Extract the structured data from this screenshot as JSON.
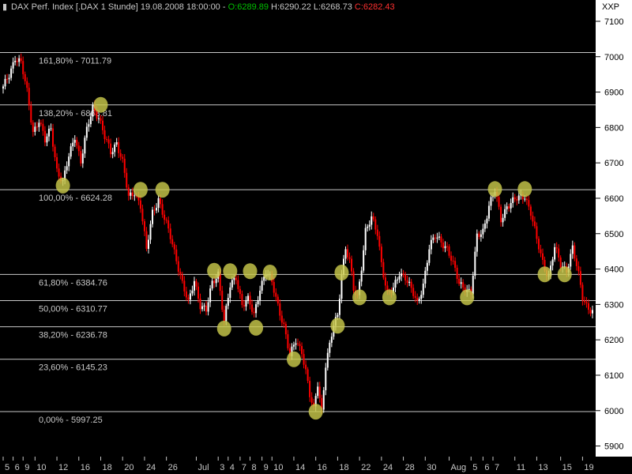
{
  "chart_data": {
    "type": "candlestick",
    "title": {
      "instrument": "DAX Perf. Index [.DAX  1 Stunde]",
      "datetime": "19.08.2008 18:00:00",
      "open": "O:6289.89",
      "high": "H:6290.22",
      "low": "L:6268.73",
      "close": "C:6282.43"
    },
    "y_axis_label": "XXP",
    "ylim": [
      5870,
      7150
    ],
    "yticks": [
      5900,
      6000,
      6100,
      6200,
      6300,
      6400,
      6500,
      6600,
      6700,
      6800,
      6900,
      7000,
      7100
    ],
    "ytick_labels": [
      "5900",
      "6000",
      "6100",
      "6200",
      "6300",
      "6400",
      "6500",
      "6600",
      "6700",
      "6800",
      "6900",
      "7000",
      "7100"
    ],
    "xticks": [
      {
        "label": "5",
        "i": 0
      },
      {
        "label": "6",
        "i": 5
      },
      {
        "label": "9",
        "i": 10
      },
      {
        "label": "10",
        "i": 16
      },
      {
        "label": "12",
        "i": 27
      },
      {
        "label": "16",
        "i": 38
      },
      {
        "label": "18",
        "i": 49
      },
      {
        "label": "20",
        "i": 60
      },
      {
        "label": "24",
        "i": 71
      },
      {
        "label": "26",
        "i": 82
      },
      {
        "label": "Jul",
        "i": 97
      },
      {
        "label": "3",
        "i": 108
      },
      {
        "label": "4",
        "i": 113
      },
      {
        "label": "7",
        "i": 119
      },
      {
        "label": "8",
        "i": 124
      },
      {
        "label": "9",
        "i": 130
      },
      {
        "label": "10",
        "i": 135
      },
      {
        "label": "14",
        "i": 146
      },
      {
        "label": "16",
        "i": 157
      },
      {
        "label": "18",
        "i": 168
      },
      {
        "label": "22",
        "i": 179
      },
      {
        "label": "24",
        "i": 190
      },
      {
        "label": "28",
        "i": 201
      },
      {
        "label": "30",
        "i": 212
      },
      {
        "label": "Aug",
        "i": 224
      },
      {
        "label": "5",
        "i": 235
      },
      {
        "label": "6",
        "i": 241
      },
      {
        "label": "7",
        "i": 246
      },
      {
        "label": "11",
        "i": 257
      },
      {
        "label": "13",
        "i": 268
      },
      {
        "label": "15",
        "i": 280
      },
      {
        "label": "19",
        "i": 291
      }
    ],
    "fib_levels": [
      {
        "label": "161,80% - 7011.79",
        "value": 7011.79
      },
      {
        "label": "138,20% - 6863.81",
        "value": 6863.81
      },
      {
        "label": "100,00% - 6624.28",
        "value": 6624.28
      },
      {
        "label": "61,80% - 6384.76",
        "value": 6384.76
      },
      {
        "label": "50,00% - 6310.77",
        "value": 6310.77
      },
      {
        "label": "38,20% - 6236.78",
        "value": 6236.78
      },
      {
        "label": "23,60% - 6145.23",
        "value": 6145.23
      },
      {
        "label": "0,00% - 5997.25",
        "value": 5997.25
      }
    ],
    "path_anchors": [
      [
        0,
        6910
      ],
      [
        3,
        6950
      ],
      [
        6,
        7000
      ],
      [
        9,
        6980
      ],
      [
        12,
        6900
      ],
      [
        15,
        6790
      ],
      [
        18,
        6820
      ],
      [
        21,
        6760
      ],
      [
        24,
        6800
      ],
      [
        27,
        6680
      ],
      [
        30,
        6640
      ],
      [
        33,
        6720
      ],
      [
        36,
        6780
      ],
      [
        39,
        6700
      ],
      [
        42,
        6790
      ],
      [
        45,
        6860
      ],
      [
        48,
        6830
      ],
      [
        51,
        6770
      ],
      [
        54,
        6730
      ],
      [
        57,
        6760
      ],
      [
        60,
        6700
      ],
      [
        63,
        6600
      ],
      [
        66,
        6620
      ],
      [
        69,
        6580
      ],
      [
        72,
        6450
      ],
      [
        75,
        6560
      ],
      [
        78,
        6600
      ],
      [
        81,
        6540
      ],
      [
        84,
        6490
      ],
      [
        87,
        6430
      ],
      [
        90,
        6360
      ],
      [
        93,
        6300
      ],
      [
        96,
        6370
      ],
      [
        99,
        6300
      ],
      [
        102,
        6280
      ],
      [
        105,
        6360
      ],
      [
        108,
        6390
      ],
      [
        111,
        6250
      ],
      [
        114,
        6350
      ],
      [
        117,
        6380
      ],
      [
        120,
        6300
      ],
      [
        123,
        6310
      ],
      [
        126,
        6270
      ],
      [
        129,
        6350
      ],
      [
        132,
        6390
      ],
      [
        135,
        6360
      ],
      [
        138,
        6300
      ],
      [
        141,
        6240
      ],
      [
        144,
        6150
      ],
      [
        147,
        6200
      ],
      [
        150,
        6170
      ],
      [
        152,
        6110
      ],
      [
        154,
        6040
      ],
      [
        156,
        6000
      ],
      [
        158,
        6080
      ],
      [
        160,
        6000
      ],
      [
        162,
        6130
      ],
      [
        164,
        6180
      ],
      [
        166,
        6240
      ],
      [
        168,
        6270
      ],
      [
        170,
        6390
      ],
      [
        172,
        6460
      ],
      [
        174,
        6420
      ],
      [
        176,
        6340
      ],
      [
        178,
        6320
      ],
      [
        180,
        6410
      ],
      [
        182,
        6510
      ],
      [
        185,
        6540
      ],
      [
        188,
        6500
      ],
      [
        190,
        6420
      ],
      [
        193,
        6330
      ],
      [
        196,
        6340
      ],
      [
        199,
        6390
      ],
      [
        202,
        6380
      ],
      [
        205,
        6340
      ],
      [
        208,
        6300
      ],
      [
        211,
        6360
      ],
      [
        214,
        6460
      ],
      [
        217,
        6490
      ],
      [
        220,
        6480
      ],
      [
        223,
        6460
      ],
      [
        226,
        6410
      ],
      [
        229,
        6360
      ],
      [
        232,
        6350
      ],
      [
        235,
        6330
      ],
      [
        238,
        6490
      ],
      [
        241,
        6510
      ],
      [
        244,
        6580
      ],
      [
        247,
        6620
      ],
      [
        250,
        6540
      ],
      [
        253,
        6580
      ],
      [
        256,
        6590
      ],
      [
        259,
        6600
      ],
      [
        262,
        6610
      ],
      [
        265,
        6560
      ],
      [
        268,
        6480
      ],
      [
        271,
        6420
      ],
      [
        274,
        6380
      ],
      [
        277,
        6460
      ],
      [
        280,
        6410
      ],
      [
        283,
        6400
      ],
      [
        286,
        6460
      ],
      [
        289,
        6380
      ],
      [
        291,
        6320
      ],
      [
        293,
        6300
      ],
      [
        296,
        6280
      ]
    ],
    "highlights": [
      {
        "i": 30,
        "value": 6636
      },
      {
        "i": 49,
        "value": 6864
      },
      {
        "i": 69,
        "value": 6624
      },
      {
        "i": 80,
        "value": 6624
      },
      {
        "i": 106,
        "value": 6395
      },
      {
        "i": 111,
        "value": 6232
      },
      {
        "i": 114,
        "value": 6394
      },
      {
        "i": 124,
        "value": 6394
      },
      {
        "i": 127,
        "value": 6234
      },
      {
        "i": 134,
        "value": 6390
      },
      {
        "i": 146,
        "value": 6145
      },
      {
        "i": 157,
        "value": 5997
      },
      {
        "i": 168,
        "value": 6240
      },
      {
        "i": 170,
        "value": 6390
      },
      {
        "i": 179,
        "value": 6320
      },
      {
        "i": 194,
        "value": 6320
      },
      {
        "i": 233,
        "value": 6320
      },
      {
        "i": 247,
        "value": 6626
      },
      {
        "i": 262,
        "value": 6626
      },
      {
        "i": 272,
        "value": 6385
      },
      {
        "i": 282,
        "value": 6385
      }
    ],
    "colors": {
      "background": "#000000",
      "up": "#ffffff",
      "down": "#ff0000",
      "fib_line": "#c8c8c8",
      "text": "#c8c8c8",
      "open_text": "#00c000",
      "close_text": "#ff3030",
      "highlight": "#c8c84a",
      "axis_bg": "#ffffff",
      "axis_text": "#000000"
    },
    "grid": false,
    "legend": "none"
  }
}
